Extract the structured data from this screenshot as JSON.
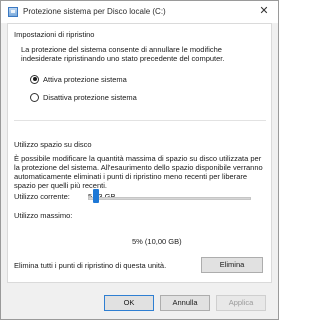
{
  "window": {
    "title": "Protezione sistema per Disco locale (C:)",
    "close_glyph": "✕",
    "app_icon": "drive-icon"
  },
  "restore_settings": {
    "heading": "Impostazioni di ripristino",
    "description": "La protezione del sistema consente di annullare le modifiche indesiderate ripristinando uno stato precedente del computer.",
    "options": [
      {
        "label": "Attiva protezione sistema",
        "checked": true
      },
      {
        "label": "Disattiva protezione sistema",
        "checked": false
      }
    ]
  },
  "disk_usage": {
    "heading": "Utilizzo spazio su disco",
    "description": "È possibile modificare la quantità massima di spazio su disco utilizzata per la protezione del sistema. All'esaurimento dello spazio disponibile verranno automaticamente eliminati i punti di ripristino meno recenti per liberare spazio per quelli più recenti.",
    "current_label": "Utilizzo corrente:",
    "current_value": "5,03 GB",
    "max_label": "Utilizzo massimo:",
    "max_percent": 5,
    "max_value_text": "5% (10,00 GB)",
    "delete_text": "Elimina tutti i punti di ripristino di questa unità.",
    "delete_button": "Elimina"
  },
  "footer": {
    "ok": "OK",
    "cancel": "Annulla",
    "apply": "Applica"
  },
  "colors": {
    "slider_thumb": "#1e78d6",
    "window_bg": "#f0f0f0",
    "panel_bg": "#ffffff"
  }
}
